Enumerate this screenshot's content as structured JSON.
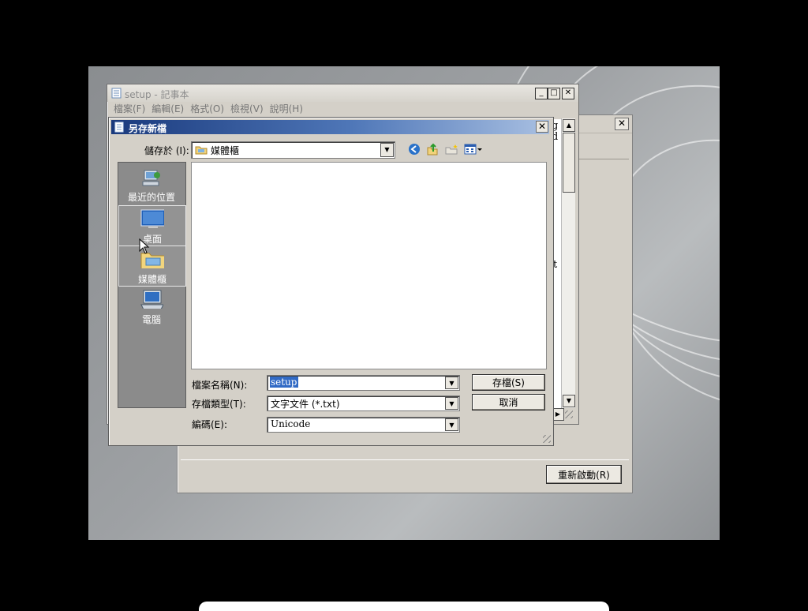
{
  "colors": {
    "title_active_start": "#1a3a7d",
    "title_active_end": "#a9c0e2",
    "window_face": "#d4d0c8",
    "places_bg": "#8b8b8b"
  },
  "setup_window": {
    "restart_button": "重新啟動(R)",
    "close_icon": "close-icon"
  },
  "notepad": {
    "title": "setup - 記事本",
    "menu": [
      "檔案(F)",
      "編輯(E)",
      "格式(O)",
      "檢視(V)",
      "說明(H)"
    ],
    "text_fragments": [
      "g",
      "d",
      "t"
    ]
  },
  "save_dialog": {
    "title": "另存新檔",
    "save_in_label": "儲存於 (I):",
    "save_in_value": "媒體櫃",
    "places": [
      {
        "label": "最近的位置",
        "icon": "recent-places-icon"
      },
      {
        "label": "桌面",
        "icon": "desktop-icon"
      },
      {
        "label": "媒體櫃",
        "icon": "library-folder-icon"
      },
      {
        "label": "電腦",
        "icon": "computer-icon"
      }
    ],
    "filename_label": "檔案名稱(N):",
    "filename_value": "setup",
    "filetype_label": "存檔類型(T):",
    "filetype_value": "文字文件 (*.txt)",
    "encoding_label": "編碼(E):",
    "encoding_value": "Unicode",
    "save_button": "存檔(S)",
    "cancel_button": "取消"
  }
}
